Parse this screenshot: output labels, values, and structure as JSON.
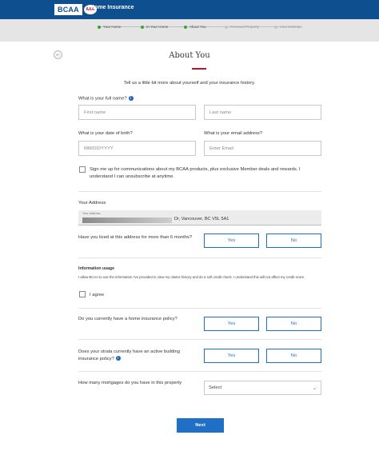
{
  "header": {
    "logo_text": "BCAA",
    "logo_badge": "AAA",
    "app_title": "Home Insurance"
  },
  "progress": {
    "steps": [
      {
        "label": "Your Home",
        "status": "done"
      },
      {
        "label": "In Your Home",
        "status": "done"
      },
      {
        "label": "About You",
        "status": "done"
      },
      {
        "label": "Personal Property",
        "status": "todo"
      },
      {
        "label": "Your Estimate",
        "status": "todo"
      }
    ]
  },
  "page": {
    "back_glyph": "←",
    "title": "About You",
    "intro": "Tell us a little bit more about yourself and your insurance history."
  },
  "form": {
    "name_label": "What is your full name?",
    "first_name_placeholder": "First name",
    "last_name_placeholder": "Last name",
    "dob_label": "What is your date of birth?",
    "dob_placeholder": "MM/DD/YYYY",
    "email_label": "What is your email address?",
    "email_placeholder": "Enter Email",
    "consent_text": "Sign me up for communications about my BCAA products, plus exclusive Member deals and rewards. I understand I can unsubscribe at anytime.",
    "address_heading": "Your Address",
    "address_field_label": "Your Address",
    "address_value": "Dr, Vancouver, BC V5L 5A1",
    "lived_question": "Have you lived at this address for more than 6 months?",
    "yes_label": "Yes",
    "no_label": "No",
    "info_usage_heading": "Information usage",
    "info_usage_text": "I allow BCAA to use the information I've provided to view my claims history and do a soft credit check. I understand this will not affect my credit score.",
    "agree_label": "I agree",
    "home_policy_question": "Do you currently have a home insurance policy?",
    "strata_question": "Does your strata currently have an active building insurance policy?",
    "mortgage_question": "How many mortgages do you have in this property",
    "mortgage_select_value": "Select",
    "next_label": "Next"
  },
  "colors": {
    "brand_blue": "#0d4f8f",
    "accent_red": "#c8102e",
    "button_blue": "#1f6fc7",
    "done_green": "#3aa335"
  }
}
